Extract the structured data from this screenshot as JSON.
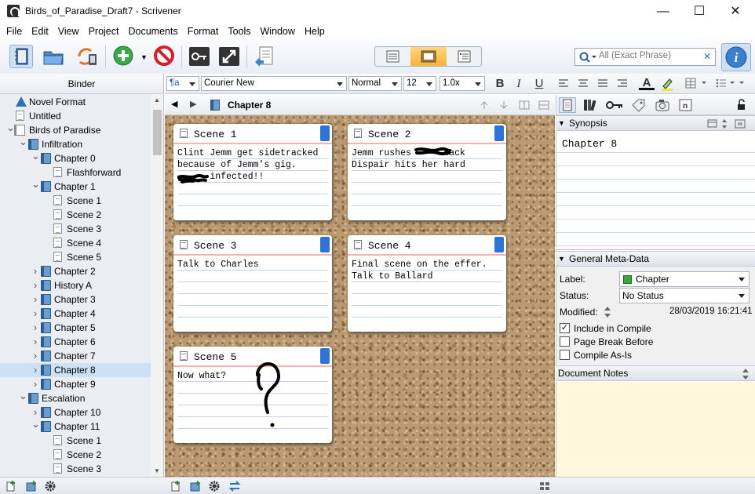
{
  "window": {
    "title": "Birds_of_Paradise_Draft7 - Scrivener",
    "minimize": "—",
    "maximize": "☐",
    "close": "✕"
  },
  "menu": [
    "File",
    "Edit",
    "View",
    "Project",
    "Documents",
    "Format",
    "Tools",
    "Window",
    "Help"
  ],
  "search": {
    "placeholder": "All (Exact Phrase)",
    "clear": "✕"
  },
  "binder": {
    "header": "Binder",
    "items": [
      {
        "label": "Novel Format",
        "icon": "warning-icon",
        "indent": 0,
        "chev": ""
      },
      {
        "label": "Untitled",
        "icon": "document-icon",
        "indent": 0,
        "chev": ""
      },
      {
        "label": "Birds of Paradise",
        "icon": "book-icon",
        "indent": 0,
        "chev": "v"
      },
      {
        "label": "Infiltration",
        "icon": "folder-icon",
        "indent": 1,
        "chev": "v"
      },
      {
        "label": "Chapter 0",
        "icon": "folder-icon",
        "indent": 2,
        "chev": "v"
      },
      {
        "label": "Flashforward",
        "icon": "document-icon",
        "indent": 3,
        "chev": ""
      },
      {
        "label": "Chapter 1",
        "icon": "folder-icon",
        "indent": 2,
        "chev": "v"
      },
      {
        "label": "Scene 1",
        "icon": "document-icon",
        "indent": 3,
        "chev": ""
      },
      {
        "label": "Scene 2",
        "icon": "document-icon",
        "indent": 3,
        "chev": ""
      },
      {
        "label": "Scene 3",
        "icon": "document-icon",
        "indent": 3,
        "chev": ""
      },
      {
        "label": "Scene 4",
        "icon": "document-icon",
        "indent": 3,
        "chev": ""
      },
      {
        "label": "Scene 5",
        "icon": "document-icon",
        "indent": 3,
        "chev": ""
      },
      {
        "label": "Chapter 2",
        "icon": "folder-icon",
        "indent": 2,
        "chev": ">"
      },
      {
        "label": "History A",
        "icon": "folder-icon",
        "indent": 2,
        "chev": ">"
      },
      {
        "label": "Chapter 3",
        "icon": "folder-icon",
        "indent": 2,
        "chev": ">"
      },
      {
        "label": "Chapter 4",
        "icon": "folder-icon",
        "indent": 2,
        "chev": ">"
      },
      {
        "label": "Chapter 5",
        "icon": "folder-icon",
        "indent": 2,
        "chev": ">"
      },
      {
        "label": "Chapter 6",
        "icon": "folder-icon",
        "indent": 2,
        "chev": ">"
      },
      {
        "label": "Chapter 7",
        "icon": "folder-icon",
        "indent": 2,
        "chev": ">"
      },
      {
        "label": "Chapter 8",
        "icon": "folder-icon",
        "indent": 2,
        "chev": ">",
        "selected": true
      },
      {
        "label": "Chapter 9",
        "icon": "folder-icon",
        "indent": 2,
        "chev": ">"
      },
      {
        "label": "Escalation",
        "icon": "folder-icon",
        "indent": 1,
        "chev": "v"
      },
      {
        "label": "Chapter 10",
        "icon": "folder-icon",
        "indent": 2,
        "chev": ">"
      },
      {
        "label": "Chapter 11",
        "icon": "folder-icon",
        "indent": 2,
        "chev": "v"
      },
      {
        "label": "Scene 1",
        "icon": "document-icon",
        "indent": 3,
        "chev": ""
      },
      {
        "label": "Scene 2",
        "icon": "document-icon",
        "indent": 3,
        "chev": ""
      },
      {
        "label": "Scene 3",
        "icon": "document-icon",
        "indent": 3,
        "chev": ""
      }
    ]
  },
  "format": {
    "style": "¶a",
    "font": "Courier New",
    "weight": "Normal",
    "size": "12",
    "spacing": "1.0x",
    "bold": "B",
    "italic": "I",
    "underline": "U",
    "textcolor": "A"
  },
  "editor": {
    "doc_title": "Chapter 8",
    "cards": [
      {
        "title": "Scene 1",
        "lines": [
          "Clint Jemm get sidetracked",
          "because of Jemm's gig.",
          "      infected!!"
        ]
      },
      {
        "title": "Scene 2",
        "lines": [
          "Jemm rushes      back",
          "Dispair hits her hard"
        ]
      },
      {
        "title": "Scene 3",
        "lines": [
          "Talk to Charles"
        ]
      },
      {
        "title": "Scene 4",
        "lines": [
          "Final scene on the effer.",
          "Talk to Ballard"
        ]
      },
      {
        "title": "Scene 5",
        "lines": [
          "Now what?"
        ]
      }
    ]
  },
  "inspector": {
    "synopsis_header": "Synopsis",
    "synopsis_text": "Chapter 8",
    "meta_header": "General Meta-Data",
    "label_label": "Label:",
    "label_value": "Chapter",
    "label_color": "#3ca83c",
    "status_label": "Status:",
    "status_value": "No Status",
    "modified_label": "Modified:",
    "modified_value": "28/03/2019 16:21:41",
    "include_compile": "Include in Compile",
    "include_checked": "✓",
    "page_break": "Page Break Before",
    "compile_as_is": "Compile As-Is",
    "notes_header": "Document Notes"
  },
  "colors": {
    "accent": "#2c74d6",
    "selection": "#cce0f6",
    "notes_bg": "#fdf8db",
    "cork": "#b99a72"
  }
}
